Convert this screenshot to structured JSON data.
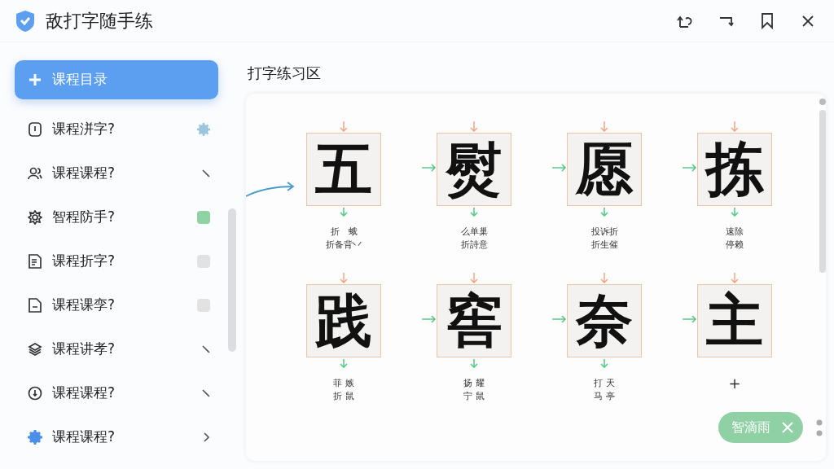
{
  "window": {
    "title": "敌打字随手练"
  },
  "sidebar": {
    "items": [
      {
        "label": "课程目录",
        "selected": true,
        "kind": "plain"
      },
      {
        "label": "课程洴字?",
        "selected": false,
        "kind": "gear"
      },
      {
        "label": "课程课程?",
        "selected": false,
        "kind": "slash"
      },
      {
        "label": "智程防手?",
        "selected": false,
        "kind": "toggle",
        "on": true
      },
      {
        "label": "课程折字?",
        "selected": false,
        "kind": "toggle",
        "on": false
      },
      {
        "label": "课程课孪?",
        "selected": false,
        "kind": "toggle",
        "on": false
      },
      {
        "label": "课程讲孝?",
        "selected": false,
        "kind": "slash"
      },
      {
        "label": "课程课程?",
        "selected": false,
        "kind": "slash"
      },
      {
        "label": "课程课程?",
        "selected": false,
        "kind": "chevron"
      }
    ]
  },
  "practice": {
    "title": "打字练习区",
    "cards": [
      {
        "character": "五",
        "caption": [
          "折　蛾",
          "折备背丷"
        ]
      },
      {
        "character": "熨",
        "caption": [
          "么单巢",
          "折詩意"
        ]
      },
      {
        "character": "愿",
        "caption": [
          "投诉折",
          "折生催"
        ]
      },
      {
        "character": "拣",
        "caption": [
          "速除",
          "停赖"
        ]
      },
      {
        "character": "践",
        "caption": [
          "菲 嫉",
          "折 鼠"
        ]
      },
      {
        "character": "窖",
        "caption": [
          "扬 耀",
          "宁 鼠"
        ]
      },
      {
        "character": "奈",
        "caption": [
          "打 天",
          "马 亭"
        ]
      },
      {
        "character": "主",
        "caption": [
          "+"
        ]
      }
    ]
  },
  "chip": {
    "label": "智滴雨"
  }
}
